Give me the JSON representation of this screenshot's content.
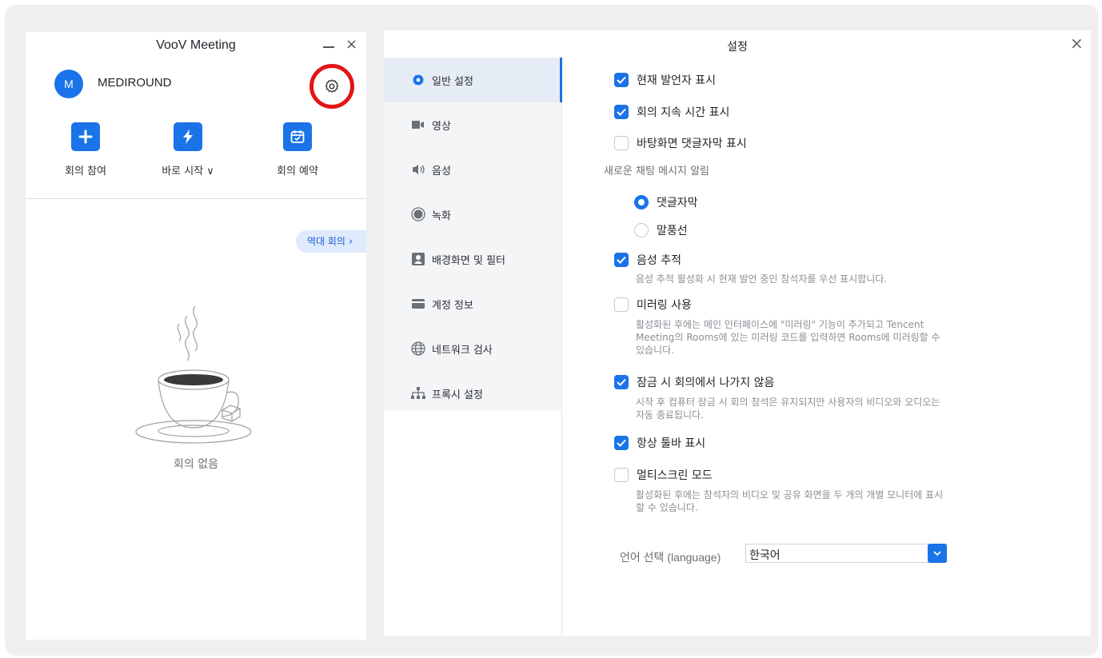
{
  "voov": {
    "title": "VooV Meeting",
    "close_glyph": "×",
    "avatar_initial": "M",
    "username": "MEDIROUND",
    "quick_actions": [
      {
        "label": "회의 참여",
        "icon": "plus-icon"
      },
      {
        "label": "바로 시작 ∨",
        "icon": "lightning-icon"
      },
      {
        "label": "회의 예약",
        "icon": "calendar-icon"
      }
    ],
    "history_button": "역대 회의",
    "history_chevron": "›",
    "empty_text": "회의 없음",
    "accent_color": "#1a73e8",
    "highlight_color": "#e21515"
  },
  "settings": {
    "title": "설정",
    "close_glyph": "×",
    "nav": [
      {
        "label": "일반 설정",
        "icon": "gear-icon",
        "active": true
      },
      {
        "label": "영상",
        "icon": "camera-icon"
      },
      {
        "label": "음성",
        "icon": "speaker-icon"
      },
      {
        "label": "녹화",
        "icon": "record-icon"
      },
      {
        "label": "배경화면 및 필터",
        "icon": "portrait-icon"
      },
      {
        "label": "계정 정보",
        "icon": "card-icon"
      },
      {
        "label": "네트워크 검사",
        "icon": "globe-icon"
      },
      {
        "label": "프록시 설정",
        "icon": "network-icon"
      }
    ],
    "options": {
      "show_speaker": {
        "label": "현재 발언자 표시",
        "checked": true
      },
      "show_duration": {
        "label": "회의 지속 시간 표시",
        "checked": true
      },
      "desktop_danmaku": {
        "label": "바탕화면 댓글자막 표시",
        "checked": false
      },
      "chat_notify_label": "새로운 채팅 메시지 알림",
      "notify_danmaku": {
        "label": "댓글자막",
        "selected": true
      },
      "notify_bubble": {
        "label": "말풍선",
        "selected": false
      },
      "voice_tracking": {
        "label": "음성 추적",
        "checked": true,
        "desc": "음성 추적 활성화 시 현재 발언 중인 참석자를 우선 표시합니다."
      },
      "mirroring": {
        "label": "미러링 사용",
        "checked": false,
        "desc": [
          "활성화된 후에는 메인 인터페이스에 \"미러링\" 기능이 추가되고 Tencent",
          "Meeting의 Rooms에 있는 미러링 코드를 입력하면 Rooms에 미러링할 수",
          "있습니다."
        ]
      },
      "stay_on_lock": {
        "label": "잠금 시 회의에서 나가지 않음",
        "checked": true,
        "desc": [
          "시작 후 컴퓨터 잠금 시 회의 참석은 유지되지만 사용자의 비디오와 오디오는",
          "자동 종료됩니다."
        ]
      },
      "always_toolbar": {
        "label": "항상 툴바 표시",
        "checked": true
      },
      "multiscreen": {
        "label": "멀티스크린 모드",
        "checked": false,
        "desc": [
          "활성화된 후에는 참석자의 비디오 및 공유 화면을 두 개의 개별 모니터에 표시",
          "할 수 있습니다."
        ]
      }
    },
    "language": {
      "label": "언어 선택 (language)",
      "value": "한국어"
    }
  }
}
